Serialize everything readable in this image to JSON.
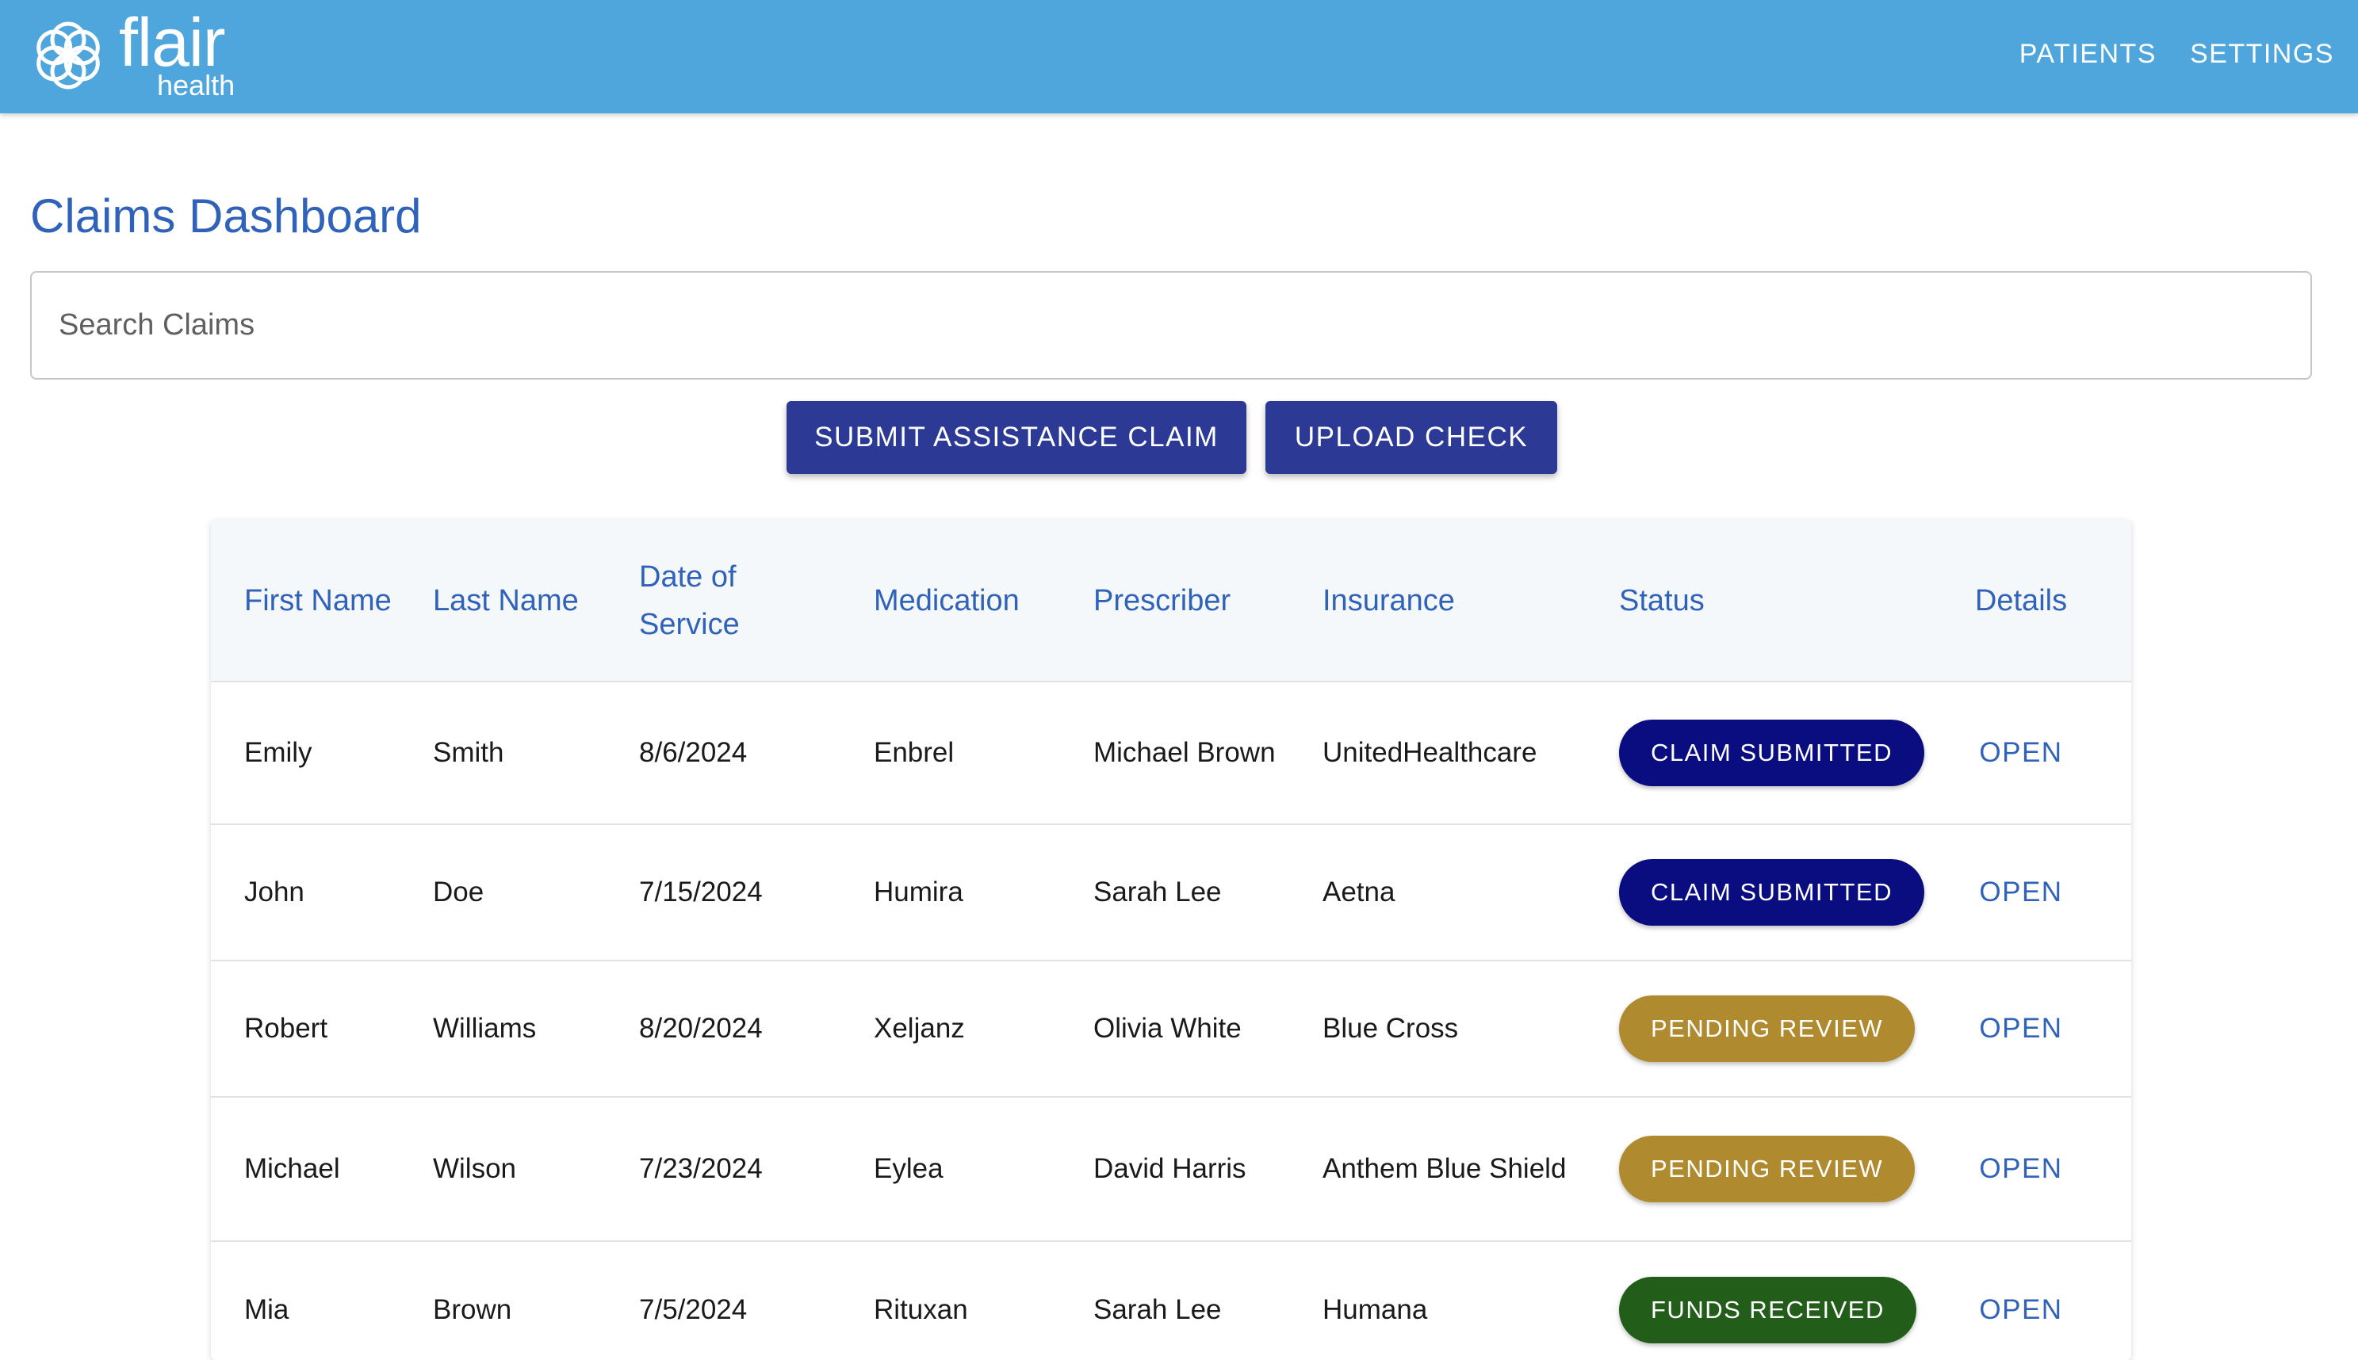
{
  "header": {
    "brand_name": "flair",
    "brand_sub": "health",
    "nav": [
      "PATIENTS",
      "SETTINGS"
    ],
    "background_color": "#4fa6dc"
  },
  "page": {
    "title": "Claims Dashboard"
  },
  "search": {
    "placeholder": "Search Claims",
    "value": ""
  },
  "actions": {
    "submit_label": "SUBMIT ASSISTANCE CLAIM",
    "upload_label": "UPLOAD CHECK",
    "button_color": "#2c3a96"
  },
  "table": {
    "columns": [
      "First Name",
      "Last Name",
      "Date of Service",
      "Medication",
      "Prescriber",
      "Insurance",
      "Status",
      "Details"
    ],
    "rows": [
      {
        "first": "Emily",
        "last": "Smith",
        "date": "8/6/2024",
        "medication": "Enbrel",
        "prescriber": "Michael Brown",
        "insurance": "UnitedHealthcare",
        "status": "CLAIM SUBMITTED",
        "details": "OPEN"
      },
      {
        "first": "John",
        "last": "Doe",
        "date": "7/15/2024",
        "medication": "Humira",
        "prescriber": "Sarah Lee",
        "insurance": "Aetna",
        "status": "CLAIM SUBMITTED",
        "details": "OPEN"
      },
      {
        "first": "Robert",
        "last": "Williams",
        "date": "8/20/2024",
        "medication": "Xeljanz",
        "prescriber": "Olivia White",
        "insurance": "Blue Cross",
        "status": "PENDING REVIEW",
        "details": "OPEN"
      },
      {
        "first": "Michael",
        "last": "Wilson",
        "date": "7/23/2024",
        "medication": "Eylea",
        "prescriber": "David Harris",
        "insurance": "Anthem Blue Shield",
        "status": "PENDING REVIEW",
        "details": "OPEN"
      },
      {
        "first": "Mia",
        "last": "Brown",
        "date": "7/5/2024",
        "medication": "Rituxan",
        "prescriber": "Sarah Lee",
        "insurance": "Humana",
        "status": "FUNDS RECEIVED",
        "details": "OPEN"
      }
    ]
  },
  "status_colors": {
    "CLAIM SUBMITTED": "#0a0d80",
    "PENDING REVIEW": "#b08a2e",
    "FUNDS RECEIVED": "#225d1a"
  }
}
